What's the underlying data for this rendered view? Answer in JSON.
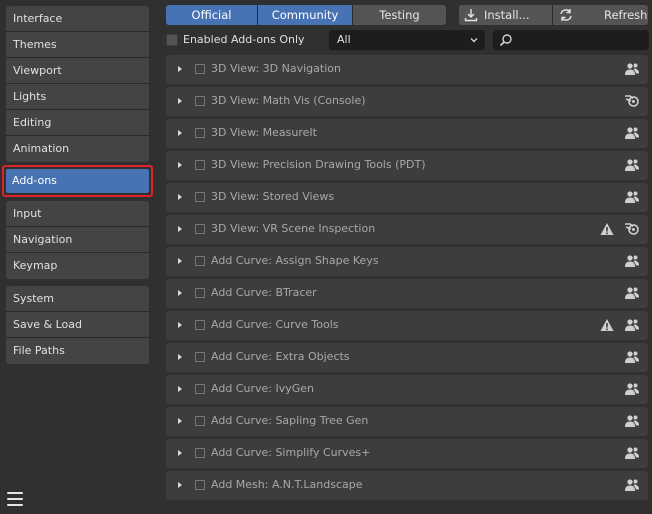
{
  "sidebar": {
    "group1": [
      {
        "label": "Interface"
      },
      {
        "label": "Themes"
      },
      {
        "label": "Viewport"
      },
      {
        "label": "Lights"
      },
      {
        "label": "Editing"
      },
      {
        "label": "Animation"
      }
    ],
    "active": {
      "label": "Add-ons"
    },
    "group2": [
      {
        "label": "Input"
      },
      {
        "label": "Navigation"
      },
      {
        "label": "Keymap"
      }
    ],
    "group3": [
      {
        "label": "System"
      },
      {
        "label": "Save & Load"
      },
      {
        "label": "File Paths"
      }
    ],
    "menu_icon": "hamburger-icon"
  },
  "toolbar": {
    "tabs": [
      {
        "label": "Official",
        "active": true
      },
      {
        "label": "Community",
        "active": true
      },
      {
        "label": "Testing",
        "active": false
      }
    ],
    "install_label": "Install...",
    "refresh_label": "Refresh"
  },
  "filter": {
    "enabled_only_label": "Enabled Add-ons Only",
    "category_value": "All",
    "search_value": ""
  },
  "addons": [
    {
      "name": "3D View: 3D Navigation",
      "warning": false,
      "support": "community"
    },
    {
      "name": "3D View: Math Vis (Console)",
      "warning": false,
      "support": "official"
    },
    {
      "name": "3D View: MeasureIt",
      "warning": false,
      "support": "community"
    },
    {
      "name": "3D View: Precision Drawing Tools (PDT)",
      "warning": false,
      "support": "community"
    },
    {
      "name": "3D View: Stored Views",
      "warning": false,
      "support": "community"
    },
    {
      "name": "3D View: VR Scene Inspection",
      "warning": true,
      "support": "official"
    },
    {
      "name": "Add Curve: Assign Shape Keys",
      "warning": false,
      "support": "community"
    },
    {
      "name": "Add Curve: BTracer",
      "warning": false,
      "support": "community"
    },
    {
      "name": "Add Curve: Curve Tools",
      "warning": true,
      "support": "community"
    },
    {
      "name": "Add Curve: Extra Objects",
      "warning": false,
      "support": "community"
    },
    {
      "name": "Add Curve: IvyGen",
      "warning": false,
      "support": "community"
    },
    {
      "name": "Add Curve: Sapling Tree Gen",
      "warning": false,
      "support": "community"
    },
    {
      "name": "Add Curve: Simplify Curves+",
      "warning": false,
      "support": "community"
    },
    {
      "name": "Add Mesh: A.N.T.Landscape",
      "warning": false,
      "support": "community"
    }
  ]
}
